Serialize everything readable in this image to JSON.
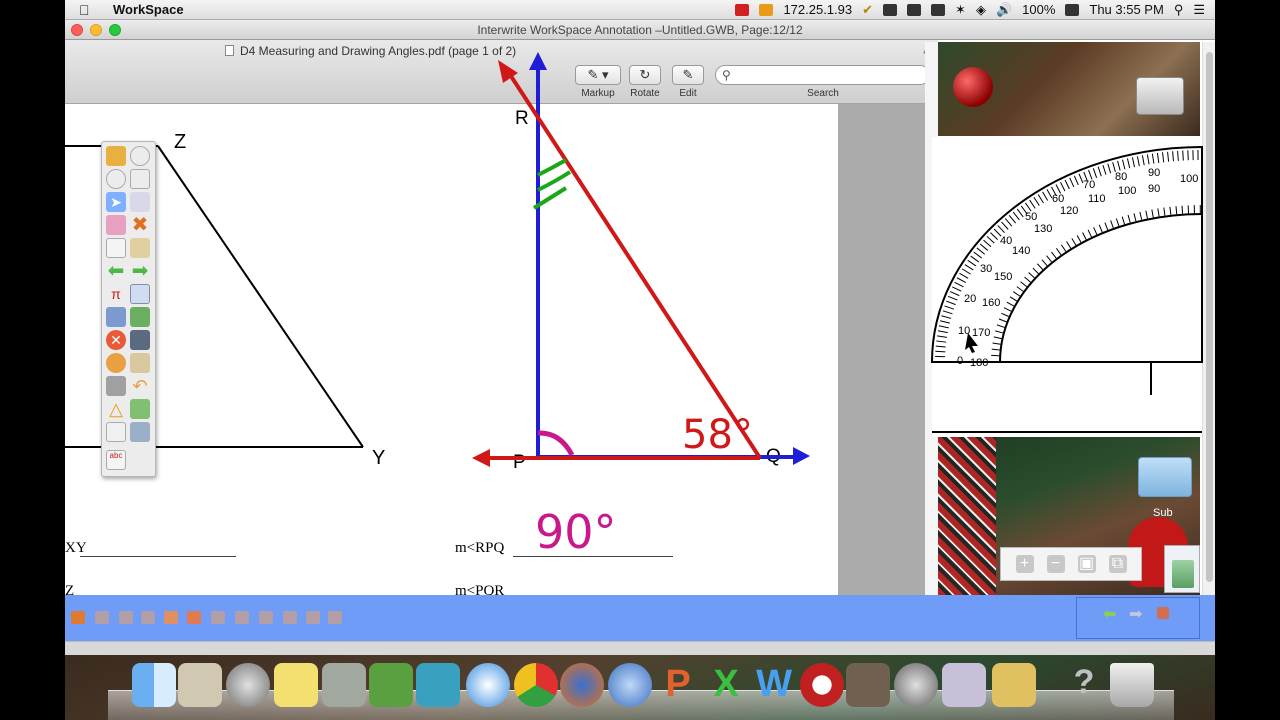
{
  "menubar": {
    "app_name": "WorkSpace",
    "ip_address": "172.25.1.93",
    "battery": "100%",
    "clock": "Thu 3:55 PM"
  },
  "window": {
    "title": "Interwrite WorkSpace Annotation –Untitled.GWB, Page:12/12"
  },
  "preview": {
    "document_title": "D4 Measuring and Drawing Angles.pdf (page 1 of 2)",
    "toolbar": {
      "markup_label": "Markup",
      "rotate_label": "Rotate",
      "edit_label": "Edit",
      "search_label": "Search",
      "search_placeholder": ""
    }
  },
  "worksheet": {
    "point_labels": {
      "z": "Z",
      "y": "Y",
      "r": "R",
      "p": "P",
      "q": "Q"
    },
    "fill_in_1_left": "XY",
    "fill_in_2_left": "Z",
    "fill_in_1_right": "m<RPQ",
    "fill_in_2_right": "m<PQR"
  },
  "annotations": {
    "angle_p": "90°",
    "angle_q": "58°"
  },
  "protractor": {
    "outer_labels": [
      "0",
      "10",
      "20",
      "30",
      "40",
      "50",
      "60",
      "70",
      "80",
      "90",
      "100"
    ],
    "inner_labels": [
      "180",
      "170",
      "160",
      "150",
      "140",
      "130",
      "120",
      "110",
      "100",
      "90"
    ]
  },
  "desktop": {
    "folder_label": "Sub"
  },
  "colors": {
    "blue_line": "#1e1ed6",
    "red_line": "#d01818",
    "green_marks": "#1aa81a",
    "magenta_text": "#c8188c",
    "toolbar_blue": "#6f9cf7"
  }
}
